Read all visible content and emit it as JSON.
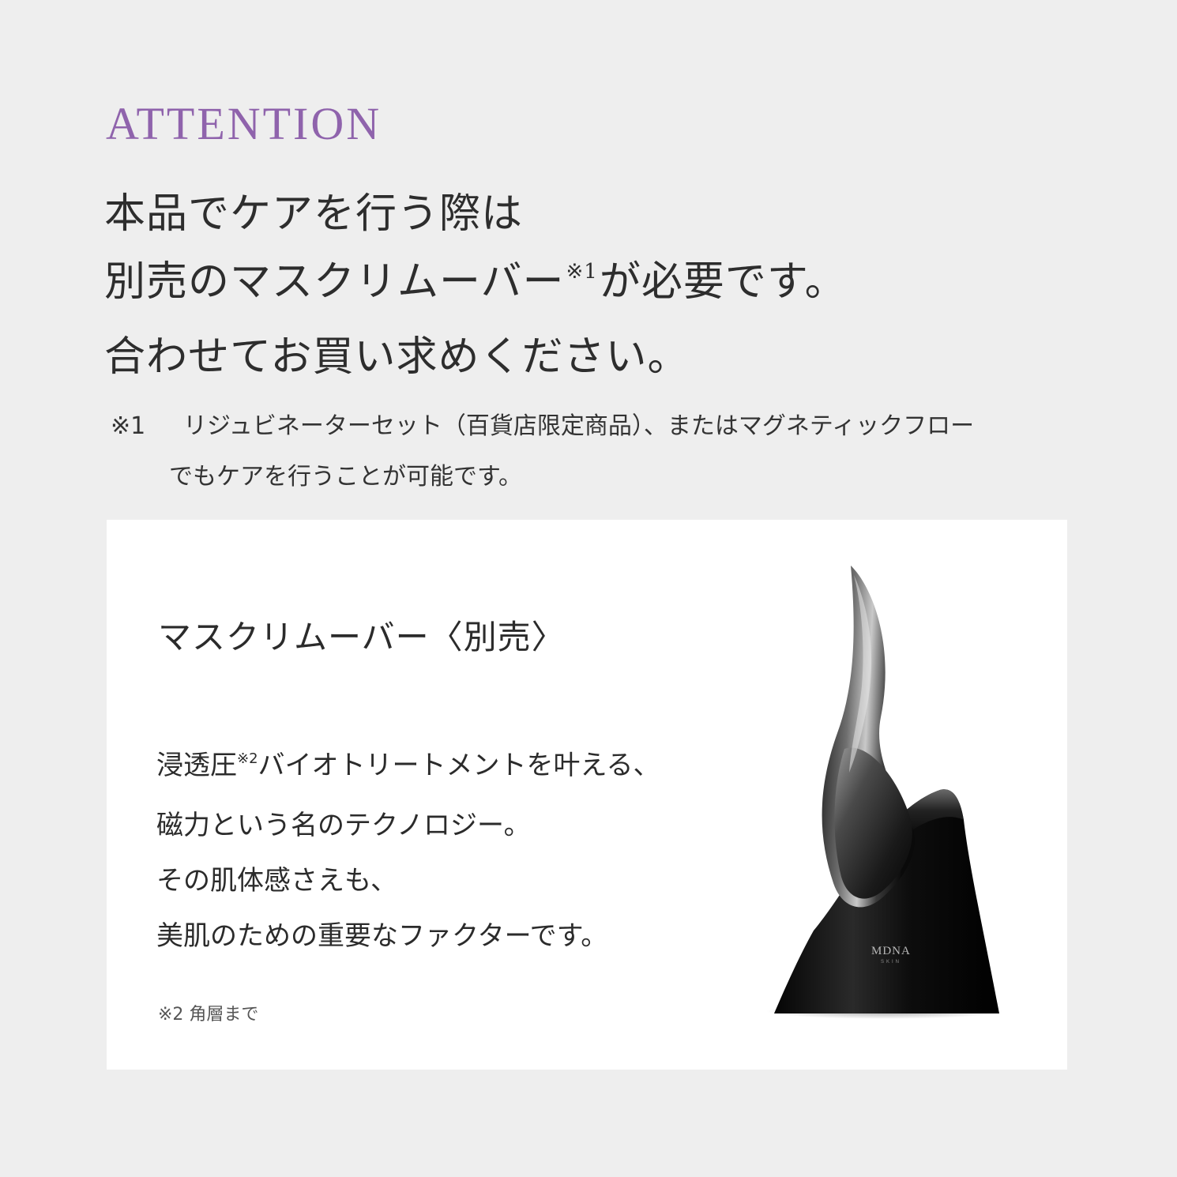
{
  "heading": {
    "label": "ATTENTION"
  },
  "headline": {
    "line1": "本品でケアを行う際は",
    "line2_before": "別売のマスクリムーバー",
    "line2_mark": "※1",
    "line2_after": "が必要です。",
    "line3": "合わせてお買い求めください。"
  },
  "footnote": {
    "mark": "※1",
    "text1": "リジュビネーターセット（百貨店限定商品）、またはマグネティックフロー",
    "text2": "でもケアを行うことが可能です。"
  },
  "card": {
    "title": "マスクリムーバー〈別売〉",
    "body_line1_before": "浸透圧",
    "body_line1_mark": "※2",
    "body_line1_after": "バイオトリートメントを叶える、",
    "body_line2": "磁力という名のテクノロジー。",
    "body_line3": "その肌体感さえも、",
    "body_line4": "美肌のための重要なファクターです。",
    "note": "※2 角層まで",
    "product_logo": "MDNA",
    "product_logo_sub": "SKIN"
  },
  "colors": {
    "accent": "#8f63ac",
    "background": "#eeeeee",
    "card": "#ffffff",
    "text": "#2b2b2b"
  }
}
